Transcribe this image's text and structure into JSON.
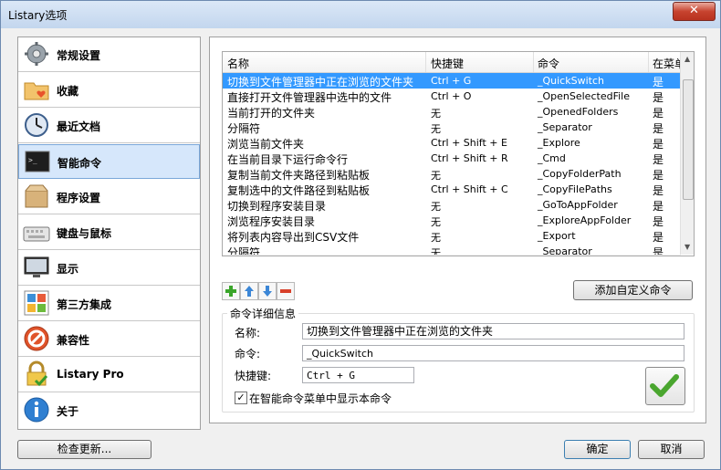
{
  "window": {
    "title": "Listary选项",
    "close_glyph": "✕"
  },
  "sidebar": {
    "items": [
      {
        "label": "常规设置",
        "icon": "gear-icon"
      },
      {
        "label": "收藏",
        "icon": "folder-heart-icon"
      },
      {
        "label": "最近文档",
        "icon": "clock-icon"
      },
      {
        "label": "智能命令",
        "icon": "terminal-icon"
      },
      {
        "label": "程序设置",
        "icon": "box-icon"
      },
      {
        "label": "键盘与鼠标",
        "icon": "keyboard-icon"
      },
      {
        "label": "显示",
        "icon": "monitor-icon"
      },
      {
        "label": "第三方集成",
        "icon": "apps-icon"
      },
      {
        "label": "兼容性",
        "icon": "no-entry-icon"
      },
      {
        "label": "Listary Pro",
        "icon": "lock-check-icon"
      },
      {
        "label": "关于",
        "icon": "info-icon"
      }
    ],
    "active_index": 3
  },
  "grid": {
    "headers": {
      "name": "名称",
      "key": "快捷键",
      "cmd": "命令",
      "menu": "在菜单"
    },
    "rows": [
      {
        "name": "切换到文件管理器中正在浏览的文件夹",
        "key": "Ctrl + G",
        "cmd": "_QuickSwitch",
        "menu": "是"
      },
      {
        "name": "直接打开文件管理器中选中的文件",
        "key": "Ctrl + O",
        "cmd": "_OpenSelectedFile",
        "menu": "是"
      },
      {
        "name": "当前打开的文件夹",
        "key": "无",
        "cmd": "_OpenedFolders",
        "menu": "是"
      },
      {
        "name": "分隔符",
        "key": "无",
        "cmd": "_Separator",
        "menu": "是"
      },
      {
        "name": "浏览当前文件夹",
        "key": "Ctrl + Shift + E",
        "cmd": "_Explore",
        "menu": "是"
      },
      {
        "name": "在当前目录下运行命令行",
        "key": "Ctrl + Shift + R",
        "cmd": "_Cmd",
        "menu": "是"
      },
      {
        "name": "复制当前文件夹路径到粘贴板",
        "key": "无",
        "cmd": "_CopyFolderPath",
        "menu": "是"
      },
      {
        "name": "复制选中的文件路径到粘贴板",
        "key": "Ctrl + Shift + C",
        "cmd": "_CopyFilePaths",
        "menu": "是"
      },
      {
        "name": "切换到程序安装目录",
        "key": "无",
        "cmd": "_GoToAppFolder",
        "menu": "是"
      },
      {
        "name": "浏览程序安装目录",
        "key": "无",
        "cmd": "_ExploreAppFolder",
        "menu": "是"
      },
      {
        "name": "将列表内容导出到CSV文件",
        "key": "无",
        "cmd": "_Export",
        "menu": "是"
      },
      {
        "name": "分隔符",
        "key": "无",
        "cmd": "_Separator",
        "menu": "是"
      }
    ],
    "selected_index": 0
  },
  "toolbar": {
    "add_custom_label": "添加自定义命令"
  },
  "details": {
    "group_title": "命令详细信息",
    "name_label": "名称:",
    "name_value": "切换到文件管理器中正在浏览的文件夹",
    "cmd_label": "命令:",
    "cmd_value": "_QuickSwitch",
    "key_label": "快捷键:",
    "key_value": "Ctrl + G",
    "show_in_menu_label": "在智能命令菜单中显示本命令",
    "show_in_menu_checked": true,
    "checkmark": "✓"
  },
  "footer": {
    "check_update_label": "检查更新...",
    "ok_label": "确定",
    "cancel_label": "取消"
  },
  "colors": {
    "selection": "#3399ff",
    "accent": "#7aa7d9",
    "close": "#c7432f"
  }
}
